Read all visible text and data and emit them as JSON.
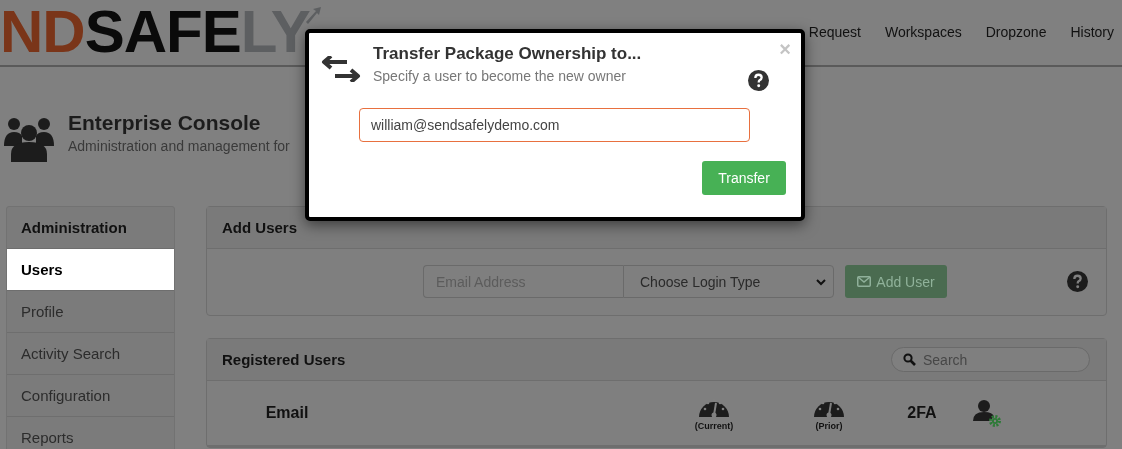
{
  "logo": {
    "parts": [
      {
        "text": "ND",
        "kind": "accent"
      },
      {
        "text": "SAFE",
        "kind": "dark"
      },
      {
        "text": "LY",
        "kind": "light"
      }
    ]
  },
  "nav": [
    "Request",
    "Workspaces",
    "Dropzone",
    "History"
  ],
  "console": {
    "title": "Enterprise Console",
    "subtitle": "Administration and management for"
  },
  "sidebar": {
    "heading": "Administration",
    "items": [
      {
        "label": "Users",
        "selected": true
      },
      {
        "label": "Profile",
        "selected": false
      },
      {
        "label": "Activity Search",
        "selected": false
      },
      {
        "label": "Configuration",
        "selected": false
      },
      {
        "label": "Reports",
        "selected": false
      }
    ]
  },
  "add_users": {
    "title": "Add Users",
    "email": {
      "placeholder": "Email Address"
    },
    "login_type": {
      "value": "Choose Login Type"
    },
    "button": "Add User"
  },
  "registered": {
    "title": "Registered Users",
    "search": {
      "placeholder": "Search"
    },
    "columns": [
      {
        "kind": "text",
        "label": "Email"
      },
      {
        "kind": "gauge",
        "label": "(Current)"
      },
      {
        "kind": "gauge",
        "label": "(Prior)"
      },
      {
        "kind": "text",
        "label": "2FA"
      },
      {
        "kind": "user-gear"
      }
    ]
  },
  "modal": {
    "title": "Transfer Package Ownership to...",
    "subtitle": "Specify a user to become the new owner",
    "input": {
      "value": "william@sendsafelydemo.com"
    },
    "button": "Transfer",
    "close": "×"
  }
}
